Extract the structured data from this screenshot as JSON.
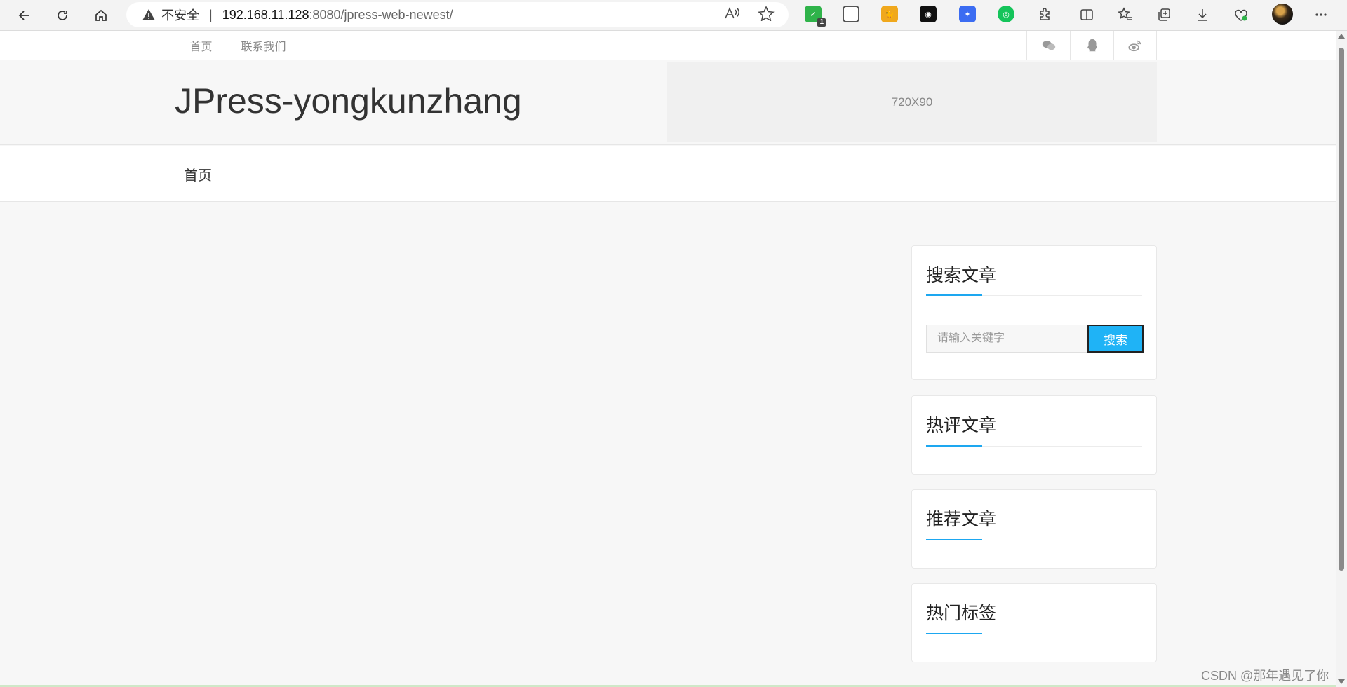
{
  "browser": {
    "address": {
      "insecure_label": "不安全",
      "separator": "|",
      "host": "192.168.11.128",
      "rest": ":8080/jpress-web-newest/"
    },
    "extensions": [
      {
        "name": "shield-extension-icon",
        "color": "#2fb34a",
        "badge": "1"
      },
      {
        "name": "collections-extension-icon",
        "color": "#555555"
      },
      {
        "name": "cat-extension-icon",
        "color": "#f0a81c"
      },
      {
        "name": "mask-extension-icon",
        "color": "#111111"
      },
      {
        "name": "bird-extension-icon",
        "color": "#3b6cf2"
      },
      {
        "name": "chat-extension-icon",
        "color": "#14c45a"
      }
    ]
  },
  "topbar": {
    "links": [
      "首页",
      "联系我们"
    ],
    "social": [
      "wechat-icon",
      "qq-icon",
      "weibo-icon"
    ]
  },
  "header": {
    "site_title": "JPress-yongkunzhang",
    "ad_label": "720X90"
  },
  "mainnav": {
    "items": [
      "首页"
    ]
  },
  "sidebar": {
    "search": {
      "title": "搜索文章",
      "placeholder": "请输入关键字",
      "button": "搜索"
    },
    "hot_comments": {
      "title": "热评文章"
    },
    "recommended": {
      "title": "推荐文章"
    },
    "hot_tags": {
      "title": "热门标签"
    }
  },
  "watermark": "CSDN @那年遇见了你",
  "colors": {
    "accent": "#1da7f0",
    "search_button": "#1fb3f6"
  }
}
